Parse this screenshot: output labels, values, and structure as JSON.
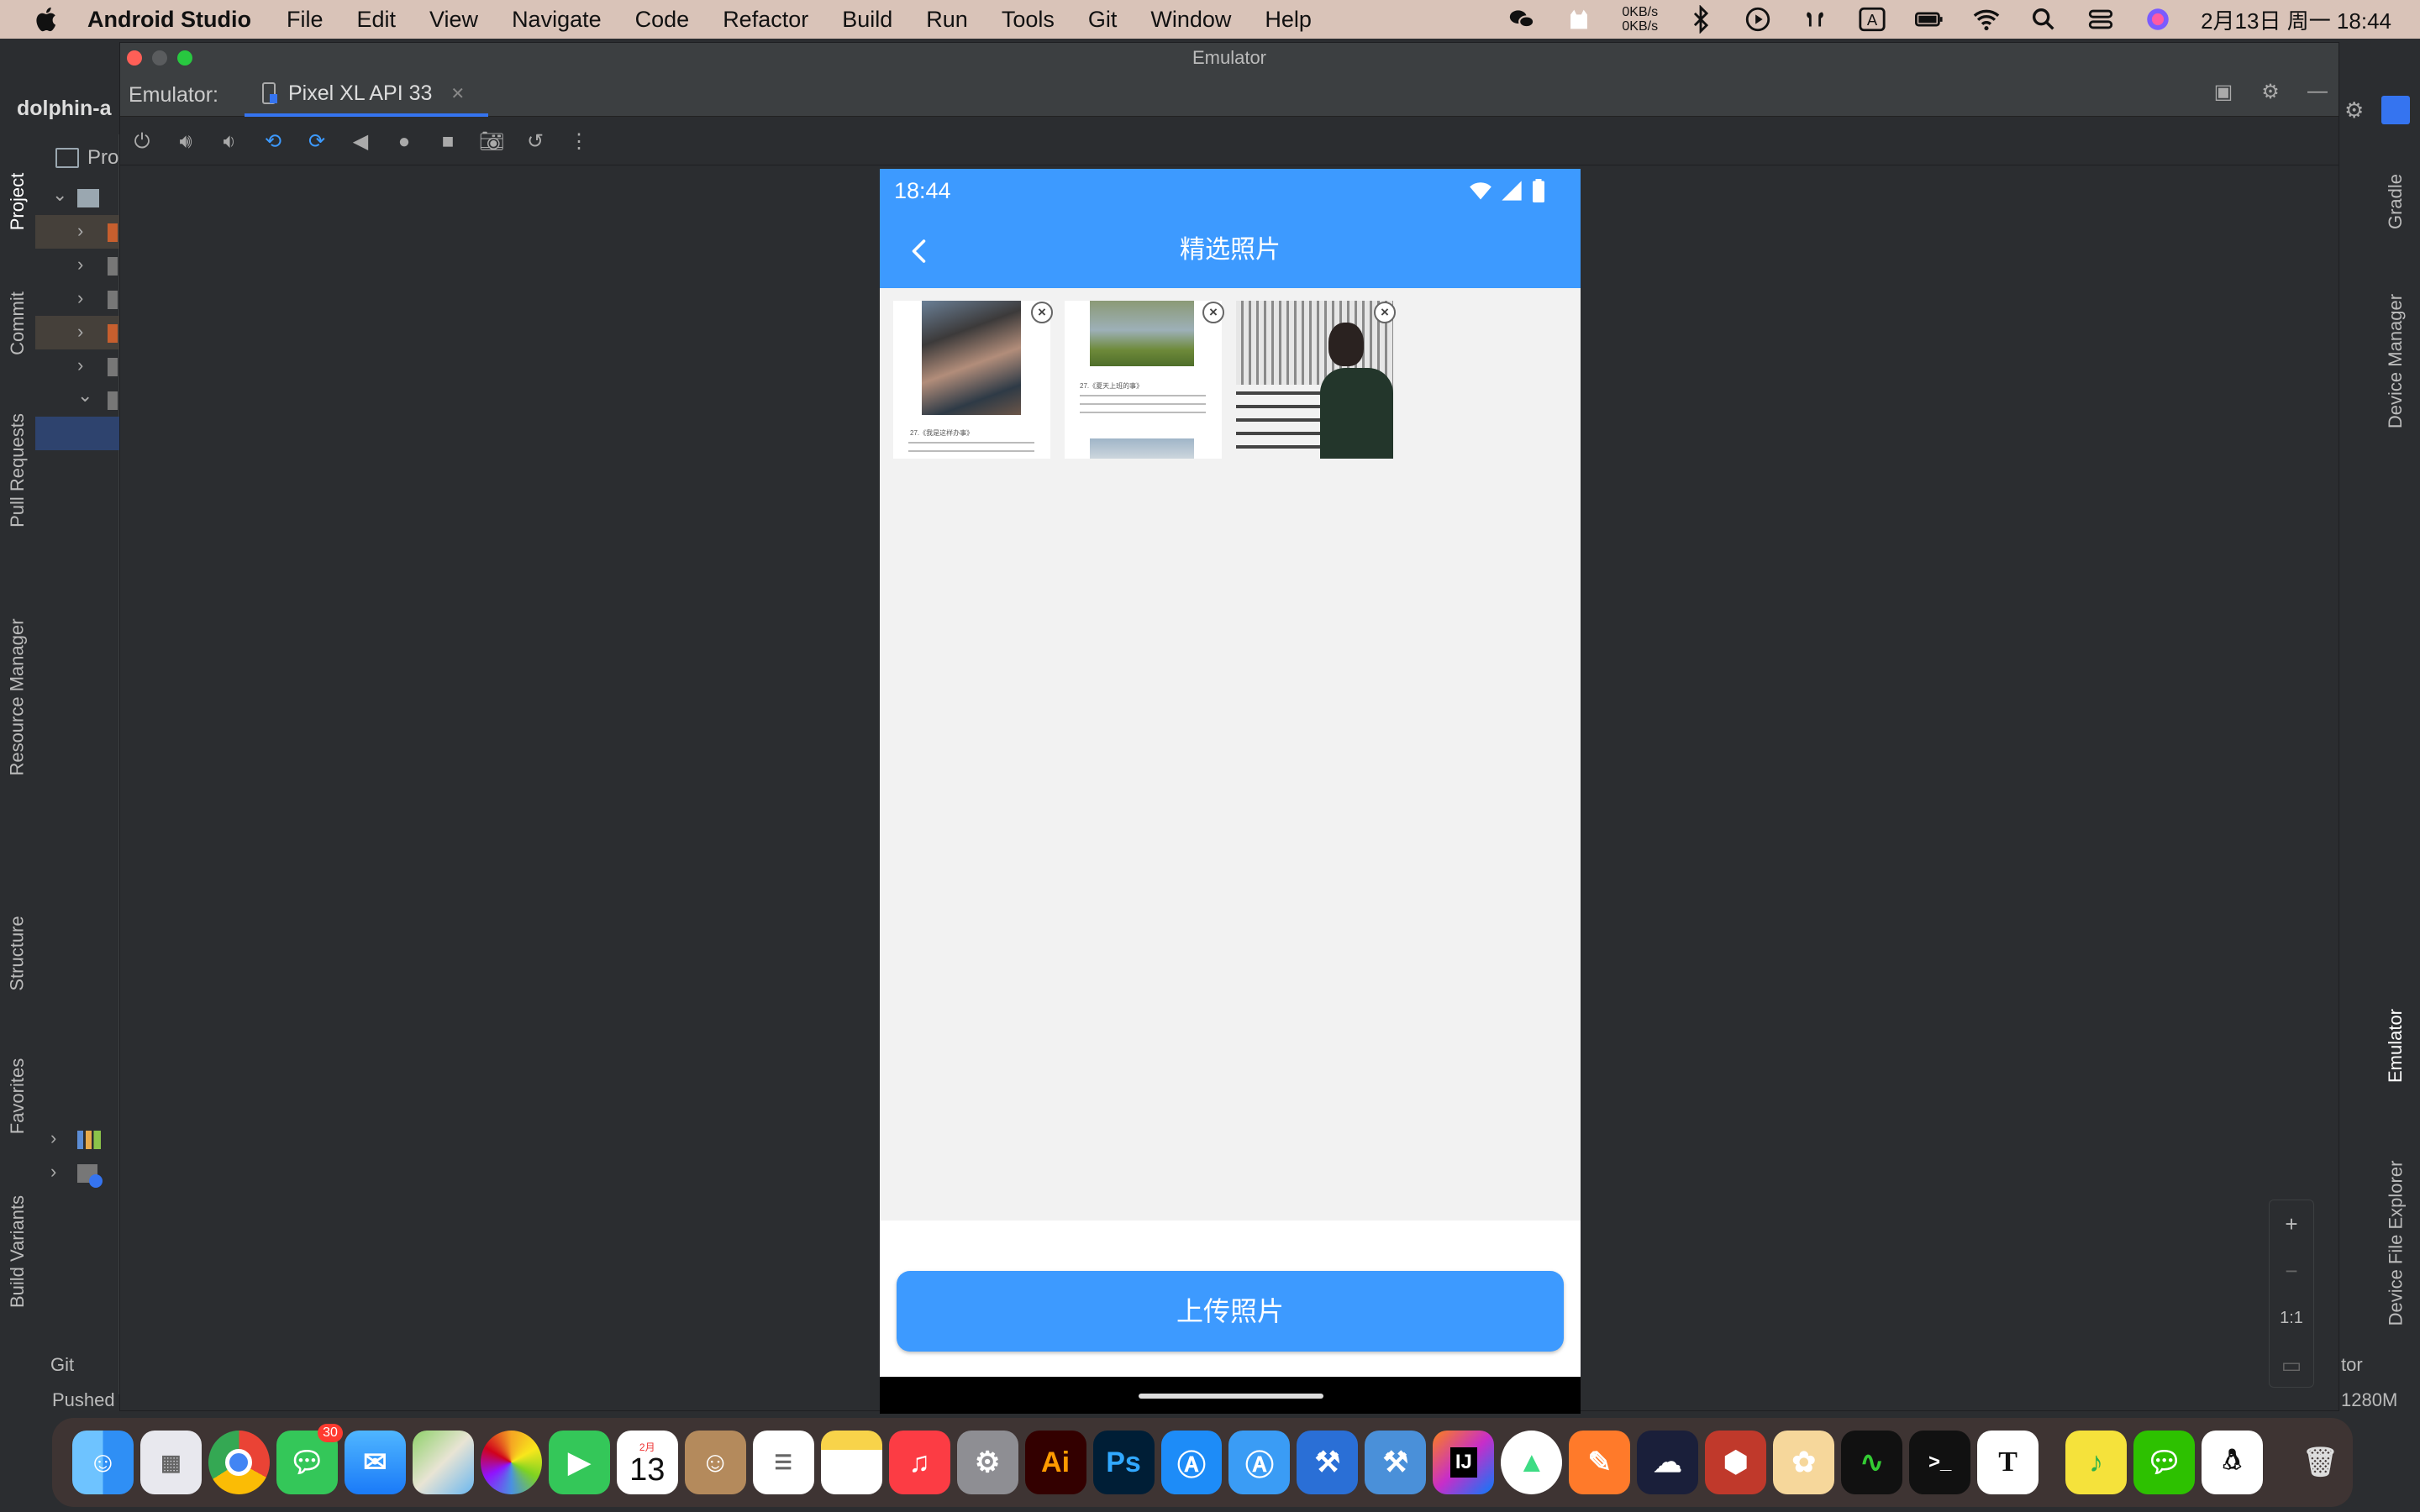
{
  "menubar": {
    "app_name": "Android Studio",
    "items": [
      "File",
      "Edit",
      "View",
      "Navigate",
      "Code",
      "Refactor",
      "Build",
      "Run",
      "Tools",
      "Git",
      "Window",
      "Help"
    ],
    "net_up": "0KB/s",
    "net_down": "0KB/s",
    "clock": "2月13日 周一  18:44"
  },
  "ide": {
    "project_title": "dolphin-a",
    "project_tab": "Pro",
    "left_tabs": [
      "Project",
      "Commit",
      "Pull Requests",
      "Resource Manager",
      "Structure",
      "Favorites",
      "Build Variants"
    ],
    "right_tabs": [
      "Gradle",
      "Device Manager",
      "Emulator",
      "Device File Explorer"
    ],
    "git_label": "Git",
    "status_text": "Pushed",
    "memory": "1280M",
    "right_tool_text": "tor"
  },
  "emulator": {
    "window_title": "Emulator",
    "label": "Emulator:",
    "tab_name": "Pixel XL API 33",
    "zoom": {
      "plus": "+",
      "minus": "−",
      "one_to_one": "1:1"
    }
  },
  "phone": {
    "time": "18:44",
    "title": "精选照片",
    "photos": [
      {
        "name": "photo-1",
        "caption": "27.《我是这样办事》"
      },
      {
        "name": "photo-2",
        "caption": "27.《夏天上班的事》"
      },
      {
        "name": "photo-3",
        "caption": ""
      }
    ],
    "upload_button": "上传照片"
  },
  "dock": {
    "messages_badge": "30",
    "calendar_month": "2月",
    "calendar_day": "13",
    "apps": [
      "finder",
      "launchpad",
      "chrome",
      "messages",
      "mail",
      "maps",
      "photos",
      "facetime",
      "calendar",
      "contacts",
      "reminders",
      "notes",
      "music",
      "system-preferences",
      "illustrator",
      "photoshop",
      "app-store",
      "app-store-2",
      "xcode",
      "instruments",
      "intellij",
      "android-studio",
      "pen-app",
      "cloud-app",
      "red-app",
      "gecko-app",
      "activity-monitor",
      "terminal",
      "typora",
      "qq-music",
      "wechat",
      "qq",
      "trash"
    ],
    "labels": {
      "illustrator": "Ai",
      "photoshop": "Ps",
      "intellij": "IJ",
      "typora": "T",
      "terminal": ">_"
    }
  },
  "colors": {
    "accent": "#3d9aff",
    "menubar": "#d9c3b8",
    "ide_bg": "#2b2d30"
  }
}
